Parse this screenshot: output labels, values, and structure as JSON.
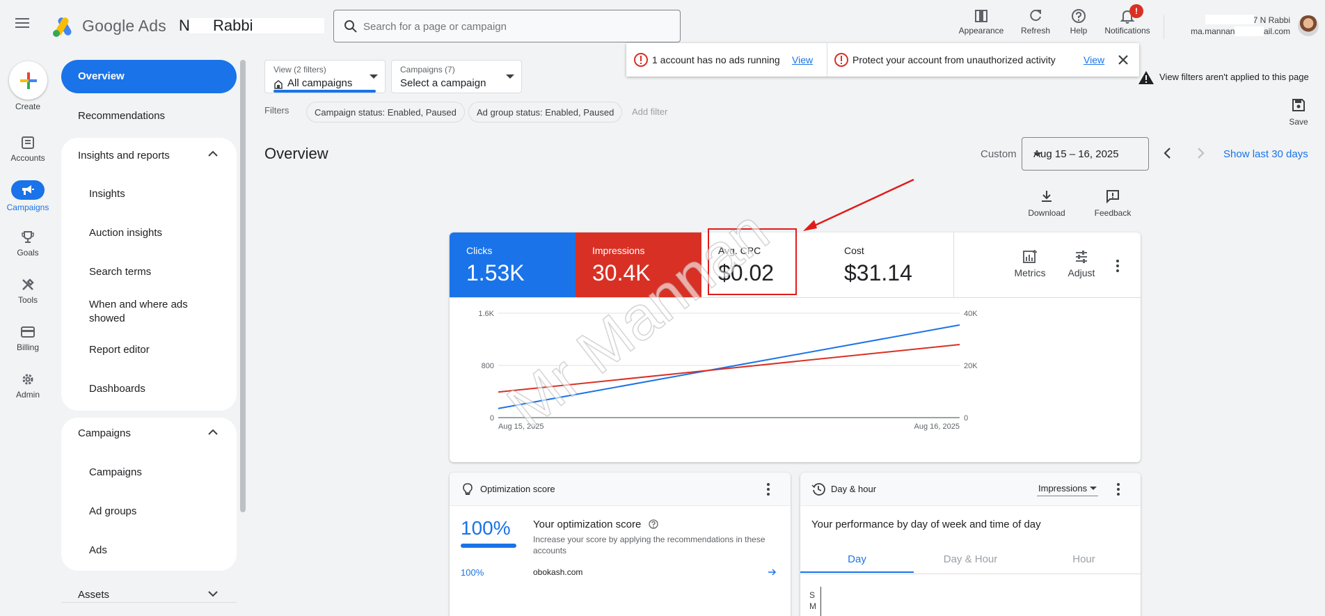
{
  "header": {
    "brand": "Google Ads",
    "account_name": "N  Rabbi",
    "search_placeholder": "Search for a page or campaign",
    "actions": [
      {
        "label": "Appearance",
        "icon": "appearance-icon"
      },
      {
        "label": "Refresh",
        "icon": "refresh-icon"
      },
      {
        "label": "Help",
        "icon": "help-icon"
      },
      {
        "label": "Notifications",
        "icon": "bell-icon"
      }
    ],
    "notification_badge": "!",
    "user_line1": "87         N  Rabbi",
    "user_line2": "ma.mannan.c        @gmail.com"
  },
  "rail": {
    "create": "Create",
    "items": [
      {
        "label": "Accounts",
        "icon": "accounts-icon"
      },
      {
        "label": "Campaigns",
        "icon": "campaigns-icon",
        "active": true
      },
      {
        "label": "Goals",
        "icon": "trophy-icon"
      },
      {
        "label": "Tools",
        "icon": "tools-icon"
      },
      {
        "label": "Billing",
        "icon": "billing-icon"
      },
      {
        "label": "Admin",
        "icon": "gear-icon"
      }
    ]
  },
  "nav": {
    "overview": "Overview",
    "recommendations": "Recommendations",
    "insights_section": {
      "title": "Insights and reports",
      "items": [
        "Insights",
        "Auction insights",
        "Search terms",
        "When and where ads showed",
        "Report editor",
        "Dashboards"
      ]
    },
    "campaigns_section": {
      "title": "Campaigns",
      "items": [
        "Campaigns",
        "Ad groups",
        "Ads"
      ]
    },
    "assets": "Assets"
  },
  "filters": {
    "view_small": "View (2 filters)",
    "view_value": "All campaigns",
    "campaigns_small": "Campaigns (7)",
    "campaigns_value": "Select a campaign",
    "label": "Filters",
    "chips": [
      "Campaign status: Enabled, Paused",
      "Ad group status: Enabled, Paused"
    ],
    "add_filter": "Add filter"
  },
  "banners": {
    "msg1": "1 account has no ads running",
    "link1": "View",
    "msg2": "Protect your account from unauthorized activity",
    "link2": "View",
    "warning": "View filters aren't applied to this page",
    "save": "Save"
  },
  "overview": {
    "title": "Overview",
    "custom": "Custom",
    "date_range": "Aug 15 – 16, 2025",
    "show_last": "Show last 30 days",
    "download": "Download",
    "feedback": "Feedback"
  },
  "metrics": {
    "tiles": [
      {
        "label": "Clicks",
        "value": "1.53K",
        "color": "#1a73e8"
      },
      {
        "label": "Impressions",
        "value": "30.4K",
        "color": "#d93025"
      },
      {
        "label": "Avg. CPC",
        "value": "$0.02",
        "color": "#ffffff"
      },
      {
        "label": "Cost",
        "value": "$31.14",
        "color": "#ffffff"
      }
    ],
    "tools": [
      "Metrics",
      "Adjust"
    ]
  },
  "chart_data": {
    "type": "line",
    "x": [
      "Aug 15, 2025",
      "Aug 16, 2025"
    ],
    "series": [
      {
        "name": "Clicks",
        "values": [
          140,
          1420
        ],
        "color": "#1a73e8",
        "axis": "left"
      },
      {
        "name": "Impressions",
        "values": [
          9800,
          28000
        ],
        "color": "#d93025",
        "axis": "right"
      }
    ],
    "y_left": {
      "ticks": [
        "1.6K",
        "800",
        "0"
      ],
      "range": [
        0,
        1600
      ]
    },
    "y_right": {
      "ticks": [
        "40K",
        "20K",
        "0"
      ],
      "range": [
        0,
        40000
      ]
    },
    "grid": true
  },
  "optimization": {
    "title": "Optimization score",
    "score": "100%",
    "score_fraction": 1.0,
    "heading": "Your optimization score",
    "description": "Increase your score by applying the recommendations in these accounts",
    "row_score": "100%",
    "row_account": "obokash.com"
  },
  "dayhour": {
    "title": "Day & hour",
    "metric": "Impressions",
    "subtitle": "Your performance by day of week and time of day",
    "tabs": [
      "Day",
      "Day & Hour",
      "Hour"
    ],
    "day_labels": [
      "S",
      "M"
    ]
  },
  "watermark": "Mr Mannan"
}
